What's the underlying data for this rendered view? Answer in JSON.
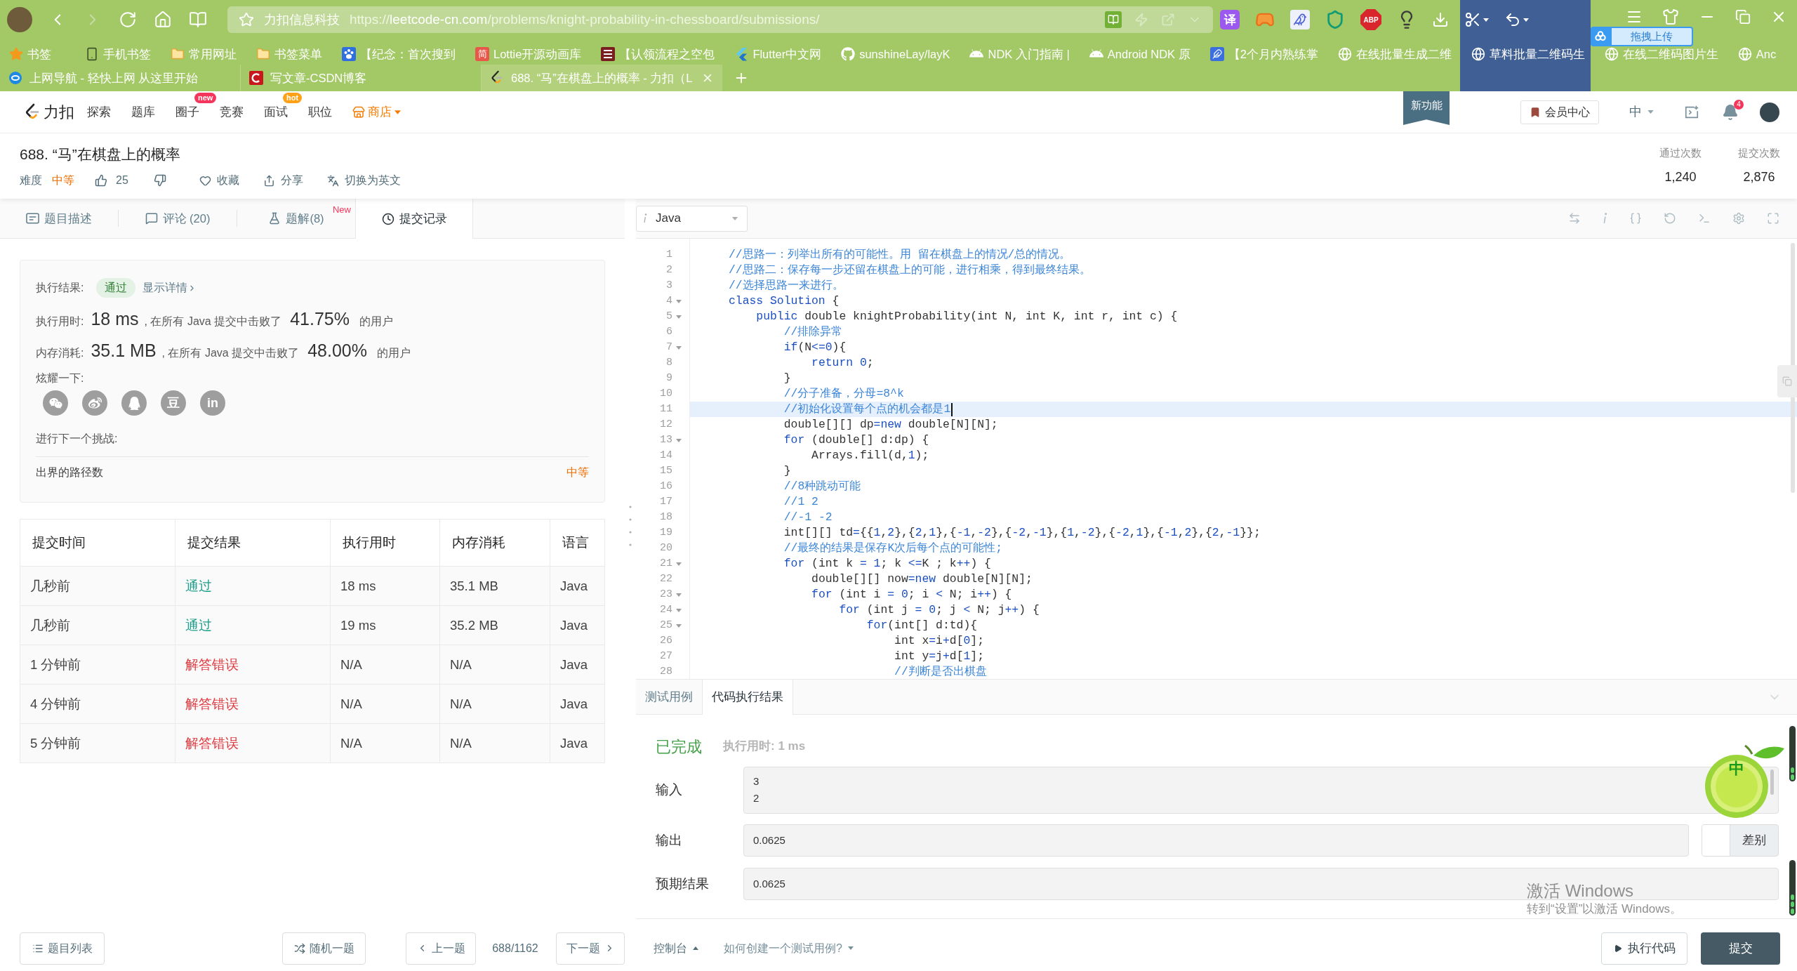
{
  "browser": {
    "navigation": [
      {
        "kind": "back",
        "disabled": false
      },
      {
        "kind": "forward",
        "disabled": true
      },
      {
        "kind": "reload",
        "disabled": false
      },
      {
        "kind": "home",
        "disabled": false
      },
      {
        "kind": "reader",
        "disabled": false
      }
    ],
    "address": {
      "site": "力扣信息科技",
      "scheme": "https://",
      "host": "leetcode-cn.com",
      "path": "/problems/knight-probability-in-chessboard/submissions/"
    },
    "extensions": [
      {
        "kind": "translate",
        "label": "译"
      },
      {
        "kind": "game"
      },
      {
        "kind": "bird"
      },
      {
        "kind": "shield"
      },
      {
        "kind": "adblock",
        "label": "ABP"
      },
      {
        "kind": "bulb"
      }
    ],
    "upload_widget": {
      "label": "拖拽上传"
    },
    "bookmarks": [
      {
        "kind": "star",
        "label": "书签"
      },
      {
        "kind": "phone",
        "label": "手机书签"
      },
      {
        "kind": "folder",
        "label": "常用网址"
      },
      {
        "kind": "folder",
        "label": "书签菜单"
      },
      {
        "kind": "paw",
        "label": "【纪念：首次搜到"
      },
      {
        "kind": "text_logo",
        "icon_text": "简",
        "label": "Lottie开源动画库"
      },
      {
        "kind": "stripes",
        "label": "【认领流程之空包"
      },
      {
        "kind": "flutter",
        "label": "Flutter中文网"
      },
      {
        "kind": "github",
        "label": "sunshineLay/layK"
      },
      {
        "kind": "android",
        "label": "NDK 入门指南 |"
      },
      {
        "kind": "android",
        "label": "Android NDK 原"
      },
      {
        "kind": "feather",
        "label": "【2个月内熟练掌"
      },
      {
        "kind": "globe",
        "label": "在线批量生成二维"
      },
      {
        "kind": "globe",
        "label": "草料批量二维码生"
      },
      {
        "kind": "globe",
        "label": "在线二维码图片生"
      },
      {
        "kind": "globe",
        "label": "Anc"
      }
    ],
    "tabs": [
      {
        "kind": "e_logo",
        "title": "上网导航 - 轻快上网 从这里开始",
        "selected": false
      },
      {
        "kind": "c_logo",
        "title": "写文章-CSDN博客",
        "selected": false
      },
      {
        "kind": "leetcode",
        "title": "688. “马”在棋盘上的概率 - 力扣（L",
        "selected": true
      }
    ]
  },
  "header": {
    "logo": "力扣",
    "nav": [
      {
        "label": "探索"
      },
      {
        "label": "题库"
      },
      {
        "label": "圈子",
        "badge": {
          "text": "new",
          "color": "#f5365c"
        }
      },
      {
        "label": "竞赛"
      },
      {
        "label": "面试",
        "badge": {
          "text": "hot",
          "color": "#ffa116"
        }
      },
      {
        "label": "职位"
      }
    ],
    "store": "商店",
    "new_feature": "新功能",
    "member": "会员中心",
    "language": "中",
    "notifications": "4"
  },
  "problem": {
    "title": "688. “马”在棋盘上的概率",
    "difficulty_label": "难度",
    "difficulty": "中等",
    "likes": "25",
    "actions": [
      {
        "kind": "favorite",
        "label": "收藏"
      },
      {
        "kind": "share",
        "label": "分享"
      },
      {
        "kind": "translate",
        "label": "切换为英文"
      }
    ],
    "stats": [
      {
        "label": "通过次数",
        "value": "1,240"
      },
      {
        "label": "提交次数",
        "value": "2,876"
      }
    ]
  },
  "panel_tabs": [
    {
      "kind": "description",
      "label": "题目描述",
      "selected": false
    },
    {
      "kind": "comments",
      "label": "评论 (20)",
      "selected": false
    },
    {
      "kind": "solutions",
      "label": "题解(8)",
      "badge": "New",
      "selected": false
    },
    {
      "kind": "submissions",
      "label": "提交记录",
      "selected": true
    }
  ],
  "result_card": {
    "result_label": "执行结果:",
    "result": "通过",
    "details": "显示详情",
    "metrics": [
      {
        "label": "执行用时:",
        "value": "18 ms",
        "text": ", 在所有 Java 提交中击败了",
        "percent": "41.75%",
        "suffix": "的用户"
      },
      {
        "label": "内存消耗:",
        "value": "35.1 MB",
        "text": ", 在所有 Java 提交中击败了",
        "percent": "48.00%",
        "suffix": "的用户"
      }
    ],
    "share_label": "炫耀一下:",
    "share_buttons": [
      {
        "kind": "wechat"
      },
      {
        "kind": "weibo"
      },
      {
        "kind": "qq"
      },
      {
        "kind": "douban",
        "label": "豆"
      },
      {
        "kind": "linkedin",
        "label": "in"
      }
    ],
    "next_label": "进行下一个挑战:",
    "next": {
      "title": "出界的路径数",
      "difficulty": "中等"
    }
  },
  "submissions": {
    "columns": [
      "提交时间",
      "提交结果",
      "执行用时",
      "内存消耗",
      "语言"
    ],
    "rows": [
      {
        "time": "几秒前",
        "result": "通过",
        "kind": "accepted",
        "runtime": "18 ms",
        "memory": "35.1 MB",
        "language": "Java"
      },
      {
        "time": "几秒前",
        "result": "通过",
        "kind": "accepted",
        "runtime": "19 ms",
        "memory": "35.2 MB",
        "language": "Java"
      },
      {
        "time": "1 分钟前",
        "result": "解答错误",
        "kind": "wrong",
        "runtime": "N/A",
        "memory": "N/A",
        "language": "Java"
      },
      {
        "time": "4 分钟前",
        "result": "解答错误",
        "kind": "wrong",
        "runtime": "N/A",
        "memory": "N/A",
        "language": "Java"
      },
      {
        "time": "5 分钟前",
        "result": "解答错误",
        "kind": "wrong",
        "runtime": "N/A",
        "memory": "N/A",
        "language": "Java"
      }
    ]
  },
  "editor": {
    "language": "Java",
    "lines": [
      {
        "number": "1",
        "foldable": false,
        "current": false,
        "tokens": [
          {
            "text": "//思路一：列举出所有的可能性。用 留在棋盘上的情况/总的情况。",
            "kind": "comment"
          }
        ]
      },
      {
        "number": "2",
        "foldable": false,
        "current": false,
        "tokens": [
          {
            "text": "//思路二：保存每一步还留在棋盘上的可能，进行相乘，得到最终结果。",
            "kind": "comment"
          }
        ]
      },
      {
        "number": "3",
        "foldable": false,
        "current": false,
        "tokens": [
          {
            "text": "//选择思路一来进行。",
            "kind": "comment"
          }
        ]
      },
      {
        "number": "4",
        "foldable": true,
        "current": false,
        "tokens": [
          {
            "text": "class Solution",
            "kind": "keyword"
          },
          {
            "text": " {",
            "kind": "plain"
          }
        ]
      },
      {
        "number": "5",
        "foldable": true,
        "current": false,
        "tokens": [
          {
            "text": "    public",
            "kind": "keyword"
          },
          {
            "text": " double knightProbability(int N, int K, int r, int c) {",
            "kind": "plain"
          }
        ]
      },
      {
        "number": "6",
        "foldable": false,
        "current": false,
        "tokens": [
          {
            "text": "        //排除异常",
            "kind": "comment"
          }
        ]
      },
      {
        "number": "7",
        "foldable": true,
        "current": false,
        "tokens": [
          {
            "text": "        if",
            "kind": "keyword"
          },
          {
            "text": "(N",
            "kind": "plain"
          },
          {
            "text": "<=",
            "kind": "operator"
          },
          {
            "text": "0",
            "kind": "number"
          },
          {
            "text": "){",
            "kind": "plain"
          }
        ]
      },
      {
        "number": "8",
        "foldable": false,
        "current": false,
        "tokens": [
          {
            "text": "            return",
            "kind": "keyword"
          },
          {
            "text": " 0",
            "kind": "number"
          },
          {
            "text": ";",
            "kind": "plain"
          }
        ]
      },
      {
        "number": "9",
        "foldable": false,
        "current": false,
        "tokens": [
          {
            "text": "        }",
            "kind": "plain"
          }
        ]
      },
      {
        "number": "10",
        "foldable": false,
        "current": false,
        "tokens": [
          {
            "text": "        //分子准备，分母=8^k",
            "kind": "comment"
          }
        ]
      },
      {
        "number": "11",
        "foldable": false,
        "current": true,
        "tokens": [
          {
            "text": "        //初始化设置每个点的机会都是1",
            "kind": "comment"
          }
        ]
      },
      {
        "number": "12",
        "foldable": false,
        "current": false,
        "tokens": [
          {
            "text": "        double[][] dp",
            "kind": "plain"
          },
          {
            "text": "=",
            "kind": "operator"
          },
          {
            "text": "new",
            "kind": "keyword"
          },
          {
            "text": " double[N][N];",
            "kind": "plain"
          }
        ]
      },
      {
        "number": "13",
        "foldable": true,
        "current": false,
        "tokens": [
          {
            "text": "        for",
            "kind": "keyword"
          },
          {
            "text": " (double[] d:dp) {",
            "kind": "plain"
          }
        ]
      },
      {
        "number": "14",
        "foldable": false,
        "current": false,
        "tokens": [
          {
            "text": "            Arrays.fill(d,",
            "kind": "plain"
          },
          {
            "text": "1",
            "kind": "number"
          },
          {
            "text": ");",
            "kind": "plain"
          }
        ]
      },
      {
        "number": "15",
        "foldable": false,
        "current": false,
        "tokens": [
          {
            "text": "        }",
            "kind": "plain"
          }
        ]
      },
      {
        "number": "16",
        "foldable": false,
        "current": false,
        "tokens": [
          {
            "text": "        //8种跳动可能",
            "kind": "comment"
          }
        ]
      },
      {
        "number": "17",
        "foldable": false,
        "current": false,
        "tokens": [
          {
            "text": "        //1 2",
            "kind": "comment"
          }
        ]
      },
      {
        "number": "18",
        "foldable": false,
        "current": false,
        "tokens": [
          {
            "text": "        //-1 -2",
            "kind": "comment"
          }
        ]
      },
      {
        "number": "19",
        "foldable": false,
        "current": false,
        "tokens": [
          {
            "text": "        int[][] td",
            "kind": "plain"
          },
          {
            "text": "=",
            "kind": "operator"
          },
          {
            "text": "{{",
            "kind": "plain"
          },
          {
            "text": "1",
            "kind": "number"
          },
          {
            "text": ",",
            "kind": "plain"
          },
          {
            "text": "2",
            "kind": "number"
          },
          {
            "text": "},{",
            "kind": "plain"
          },
          {
            "text": "2",
            "kind": "number"
          },
          {
            "text": ",",
            "kind": "plain"
          },
          {
            "text": "1",
            "kind": "number"
          },
          {
            "text": "},{",
            "kind": "plain"
          },
          {
            "text": "-1",
            "kind": "number"
          },
          {
            "text": ",",
            "kind": "plain"
          },
          {
            "text": "-2",
            "kind": "number"
          },
          {
            "text": "},{",
            "kind": "plain"
          },
          {
            "text": "-2",
            "kind": "number"
          },
          {
            "text": ",",
            "kind": "plain"
          },
          {
            "text": "-1",
            "kind": "number"
          },
          {
            "text": "},{",
            "kind": "plain"
          },
          {
            "text": "1",
            "kind": "number"
          },
          {
            "text": ",",
            "kind": "plain"
          },
          {
            "text": "-2",
            "kind": "number"
          },
          {
            "text": "},{",
            "kind": "plain"
          },
          {
            "text": "-2",
            "kind": "number"
          },
          {
            "text": ",",
            "kind": "plain"
          },
          {
            "text": "1",
            "kind": "number"
          },
          {
            "text": "},{",
            "kind": "plain"
          },
          {
            "text": "-1",
            "kind": "number"
          },
          {
            "text": ",",
            "kind": "plain"
          },
          {
            "text": "2",
            "kind": "number"
          },
          {
            "text": "},{",
            "kind": "plain"
          },
          {
            "text": "2",
            "kind": "number"
          },
          {
            "text": ",",
            "kind": "plain"
          },
          {
            "text": "-1",
            "kind": "number"
          },
          {
            "text": "}};",
            "kind": "plain"
          }
        ]
      },
      {
        "number": "20",
        "foldable": false,
        "current": false,
        "tokens": [
          {
            "text": "        //最终的结果是保存K次后每个点的可能性;",
            "kind": "comment"
          }
        ]
      },
      {
        "number": "21",
        "foldable": true,
        "current": false,
        "tokens": [
          {
            "text": "        for",
            "kind": "keyword"
          },
          {
            "text": " (int k ",
            "kind": "plain"
          },
          {
            "text": "=",
            "kind": "operator"
          },
          {
            "text": " 1",
            "kind": "number"
          },
          {
            "text": "; k ",
            "kind": "plain"
          },
          {
            "text": "<=",
            "kind": "operator"
          },
          {
            "text": "K ; k",
            "kind": "plain"
          },
          {
            "text": "++",
            "kind": "operator"
          },
          {
            "text": ") {",
            "kind": "plain"
          }
        ]
      },
      {
        "number": "22",
        "foldable": false,
        "current": false,
        "tokens": [
          {
            "text": "            double[][] now",
            "kind": "plain"
          },
          {
            "text": "=",
            "kind": "operator"
          },
          {
            "text": "new",
            "kind": "keyword"
          },
          {
            "text": " double[N][N];",
            "kind": "plain"
          }
        ]
      },
      {
        "number": "23",
        "foldable": true,
        "current": false,
        "tokens": [
          {
            "text": "            for",
            "kind": "keyword"
          },
          {
            "text": " (int i ",
            "kind": "plain"
          },
          {
            "text": "=",
            "kind": "operator"
          },
          {
            "text": " 0",
            "kind": "number"
          },
          {
            "text": "; i ",
            "kind": "plain"
          },
          {
            "text": "<",
            "kind": "operator"
          },
          {
            "text": " N; i",
            "kind": "plain"
          },
          {
            "text": "++",
            "kind": "operator"
          },
          {
            "text": ") {",
            "kind": "plain"
          }
        ]
      },
      {
        "number": "24",
        "foldable": true,
        "current": false,
        "tokens": [
          {
            "text": "                for",
            "kind": "keyword"
          },
          {
            "text": " (int j ",
            "kind": "plain"
          },
          {
            "text": "=",
            "kind": "operator"
          },
          {
            "text": " 0",
            "kind": "number"
          },
          {
            "text": "; j ",
            "kind": "plain"
          },
          {
            "text": "<",
            "kind": "operator"
          },
          {
            "text": " N; j",
            "kind": "plain"
          },
          {
            "text": "++",
            "kind": "operator"
          },
          {
            "text": ") {",
            "kind": "plain"
          }
        ]
      },
      {
        "number": "25",
        "foldable": true,
        "current": false,
        "tokens": [
          {
            "text": "                    for",
            "kind": "keyword"
          },
          {
            "text": "(int[] d:td){",
            "kind": "plain"
          }
        ]
      },
      {
        "number": "26",
        "foldable": false,
        "current": false,
        "tokens": [
          {
            "text": "                        int x",
            "kind": "plain"
          },
          {
            "text": "=",
            "kind": "operator"
          },
          {
            "text": "i",
            "kind": "plain"
          },
          {
            "text": "+",
            "kind": "operator"
          },
          {
            "text": "d[",
            "kind": "plain"
          },
          {
            "text": "0",
            "kind": "number"
          },
          {
            "text": "];",
            "kind": "plain"
          }
        ]
      },
      {
        "number": "27",
        "foldable": false,
        "current": false,
        "tokens": [
          {
            "text": "                        int y",
            "kind": "plain"
          },
          {
            "text": "=",
            "kind": "operator"
          },
          {
            "text": "j",
            "kind": "plain"
          },
          {
            "text": "+",
            "kind": "operator"
          },
          {
            "text": "d[",
            "kind": "plain"
          },
          {
            "text": "1",
            "kind": "number"
          },
          {
            "text": "];",
            "kind": "plain"
          }
        ]
      },
      {
        "number": "28",
        "foldable": false,
        "current": false,
        "tokens": [
          {
            "text": "                        //判断是否出棋盘",
            "kind": "comment"
          }
        ]
      }
    ]
  },
  "console": {
    "tabs": [
      {
        "label": "测试用例",
        "selected": false
      },
      {
        "label": "代码执行结果",
        "selected": true
      }
    ],
    "status": "已完成",
    "runtime": "执行用时: 1 ms",
    "fields": [
      {
        "kind": "multiline",
        "label": "输入",
        "lines": [
          "3",
          "2"
        ]
      },
      {
        "kind": "output",
        "label": "输出",
        "value": "0.0625",
        "diff": {
          "label": "差别",
          "on": false
        }
      },
      {
        "kind": "text",
        "label": "预期结果",
        "value": "0.0625"
      }
    ]
  },
  "footer": {
    "problem_list": "题目列表",
    "random": "随机一题",
    "prev": "上一题",
    "progress": "688/1162",
    "next": "下一题",
    "console": "控制台",
    "help": "如何创建一个测试用例?",
    "run": "执行代码",
    "submit": "提交"
  },
  "floating_widget": {
    "label": "中"
  },
  "os_notice": {
    "title": "激活 Windows",
    "text": "转到“设置”以激活 Windows。"
  }
}
